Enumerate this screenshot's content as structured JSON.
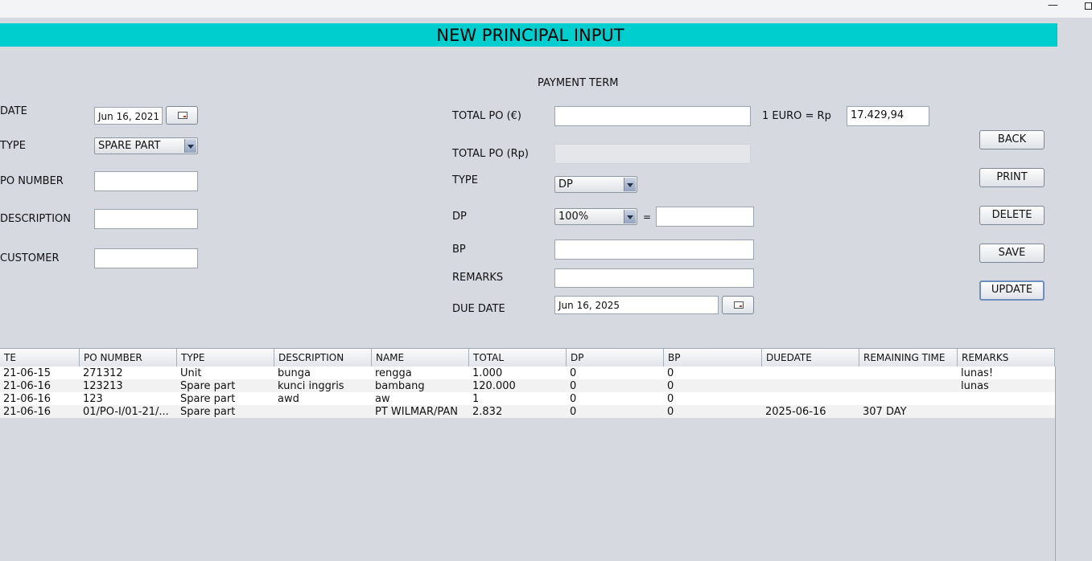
{
  "window": {
    "minimize_icon": "minimize-icon",
    "maximize_icon": "maximize-icon"
  },
  "title": "NEW PRINCIPAL INPUT",
  "colors": {
    "title_bar": "#00cdcd",
    "panel": "#d6d9e0"
  },
  "left_form": {
    "date_label": "DATE",
    "date_value": "Jun 16, 2021",
    "type_label": "TYPE",
    "type_value": "SPARE PART",
    "po_number_label": "PO NUMBER",
    "po_number_value": "",
    "description_label": "DESCRIPTION",
    "description_value": "",
    "customer_label": "CUSTOMER",
    "customer_value": ""
  },
  "payment": {
    "section_title": "PAYMENT TERM",
    "total_po_eur_label": "TOTAL PO (€)",
    "total_po_eur_value": "",
    "rate_label": "1 EURO = Rp",
    "rate_value": "17.429,94",
    "total_po_rp_label": "TOTAL PO (Rp)",
    "total_po_rp_value": "",
    "type_label": "TYPE",
    "type_value": "DP",
    "dp_label": "DP",
    "dp_percent": "100%",
    "equals": "=",
    "dp_value": "",
    "bp_label": "BP",
    "bp_value": "",
    "remarks_label": "REMARKS",
    "remarks_value": "",
    "due_date_label": "DUE DATE",
    "due_date_value": "Jun 16, 2025"
  },
  "buttons": {
    "back": "BACK",
    "print": "PRINT",
    "delete": "DELETE",
    "save": "SAVE",
    "update": "UPDATE"
  },
  "table": {
    "columns": [
      "TE",
      "PO NUMBER",
      "TYPE",
      "DESCRIPTION",
      "NAME",
      "TOTAL",
      "DP",
      "BP",
      "DUEDATE",
      "REMAINING TIME",
      "REMARKS"
    ],
    "rows": [
      [
        "21-06-15",
        "271312",
        "Unit",
        "bunga",
        "rengga",
        "1.000",
        "0",
        "0",
        "",
        "",
        "lunas!"
      ],
      [
        "21-06-16",
        "123213",
        "Spare part",
        "kunci inggris",
        "bambang",
        "120.000",
        "0",
        "0",
        "",
        "",
        "lunas"
      ],
      [
        "21-06-16",
        "123",
        "Spare part",
        "awd",
        "aw",
        "1",
        "0",
        "0",
        "",
        "",
        ""
      ],
      [
        "21-06-16",
        "01/PO-I/01-21/...",
        "Spare part",
        "",
        "PT WILMAR/PAN",
        "2.832",
        "0",
        "0",
        "2025-06-16",
        "307 DAY",
        ""
      ]
    ]
  }
}
